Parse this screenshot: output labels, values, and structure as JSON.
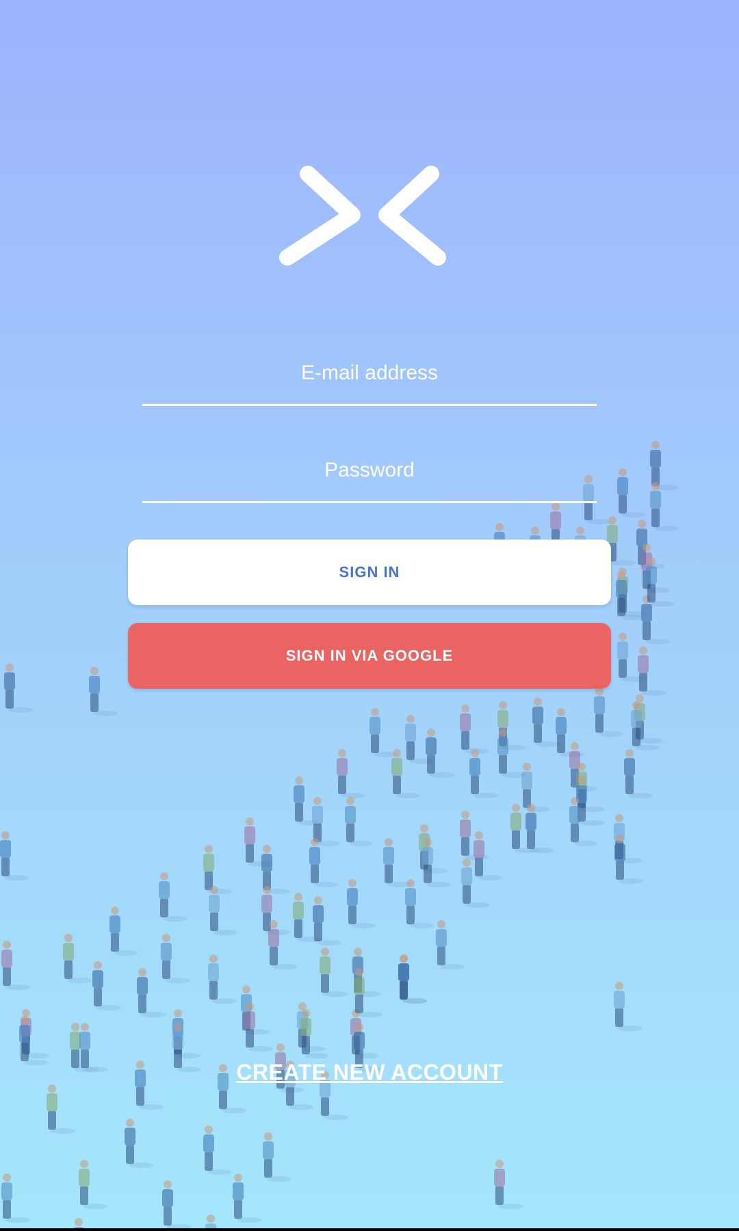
{
  "app": {
    "logo_icon": "chevrons-facing-in-icon"
  },
  "form": {
    "email_placeholder": "E-mail address",
    "password_placeholder": "Password"
  },
  "buttons": {
    "sign_in_label": "SIGN IN",
    "google_label": "SIGN IN VIA GOOGLE"
  },
  "links": {
    "create_account_label": "CREATE NEW ACCOUNT"
  },
  "colors": {
    "background_top": "#9db3fe",
    "background_bottom": "#a4e6fb",
    "sign_in_text": "#4a72cf",
    "google_button": "#eb6464",
    "text_light": "#ffffff"
  },
  "background": {
    "illustration": "crowd-of-people-illustration"
  }
}
